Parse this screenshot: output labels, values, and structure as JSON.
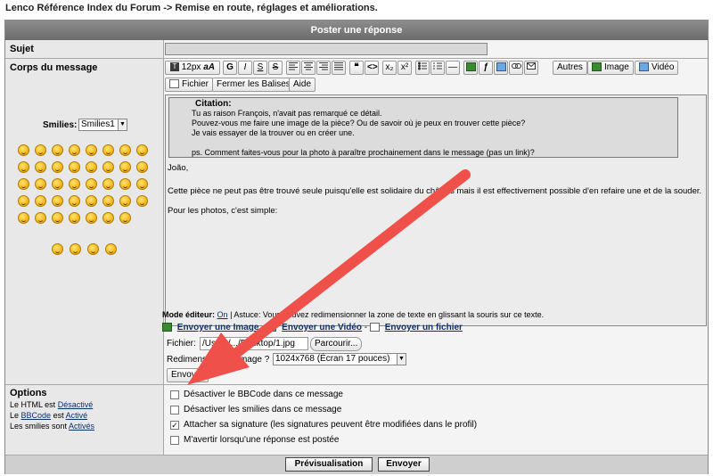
{
  "breadcrumb": {
    "text": "Lenco Référence Index du Forum -> Remise en route, réglages et améliorations."
  },
  "form": {
    "title": "Poster une réponse",
    "subject_label": "Sujet",
    "body_label": "Corps du message",
    "smilies_label": "Smilies:",
    "smilies_select": "Smilies1",
    "options_label": "Options"
  },
  "toolbar": {
    "font_size": "12px",
    "font_style": "aA",
    "bold": "G",
    "italic": "I",
    "underline": "S",
    "strike": "S",
    "quote": "❝",
    "code": "<>",
    "subscript": "x₂",
    "superscript": "x²",
    "hr": "—",
    "flash": "ƒ",
    "autres": "Autres",
    "image": "Image",
    "video": "Vidéo",
    "fichier": "Fichier",
    "fermer": "Fermer les Balises",
    "aide": "Aide"
  },
  "editor": {
    "quote_title": "Citation:",
    "quote_lines": [
      "Tu as raison François, n'avait pas remarqué ce détail.",
      "Pouvez-vous me faire une image de la pièce? Ou de savoir où je peux en trouver cette pièce?",
      "Je vais essayer de la trouver ou en créer une.",
      "",
      "ps. Comment faites-vous pour la photo à paraître prochainement dans le message (pas un link)?"
    ],
    "greeting": "João,",
    "paragraph1": "Cette pièce ne peut pas être trouvé seule puisqu'elle est solidaire du châssis mais il est effectivement possible d'en refaire une et de la souder.",
    "paragraph2": "Pour les photos, c'est simple:"
  },
  "editor_mode": {
    "label": "Mode éditeur:",
    "mode": "On",
    "hint": "| Astuce: Vous pouvez redimensionner la zone de texte en glissant la souris sur ce texte."
  },
  "uploads": {
    "send_image": "Envoyer une Image",
    "send_video": "Envoyer une Vidéo",
    "send_file": "Envoyer un fichier",
    "sep": "-",
    "file_label": "Fichier:",
    "file_value": "/Users/.../Desktop/1.jpg",
    "browse": "Parcourir...",
    "resize_label": "Redimensionner l'image ?",
    "resize_value": "1024x768 (Écran 17 pouces)",
    "send": "Envoyer"
  },
  "options": {
    "html_prefix": "Le HTML est",
    "html_state": "Désactivé",
    "bbcode_prefix": "Le",
    "bbcode_link": "BBCode",
    "bbcode_mid": "est",
    "bbcode_state": "Activé",
    "smilies_prefix": "Les smilies sont",
    "smilies_state": "Activés",
    "checks": [
      {
        "label": "Désactiver le BBCode dans ce message",
        "checked": false
      },
      {
        "label": "Désactiver les smilies dans ce message",
        "checked": false
      },
      {
        "label": "Attacher sa signature (les signatures peuvent être modifiées dans le profil)",
        "checked": true
      },
      {
        "label": "M'avertir lorsqu'une réponse est postée",
        "checked": false
      }
    ]
  },
  "footer": {
    "preview": "Prévisualisation",
    "submit": "Envoyer"
  },
  "colors": {
    "annotation_arrow": "#f0504a"
  }
}
